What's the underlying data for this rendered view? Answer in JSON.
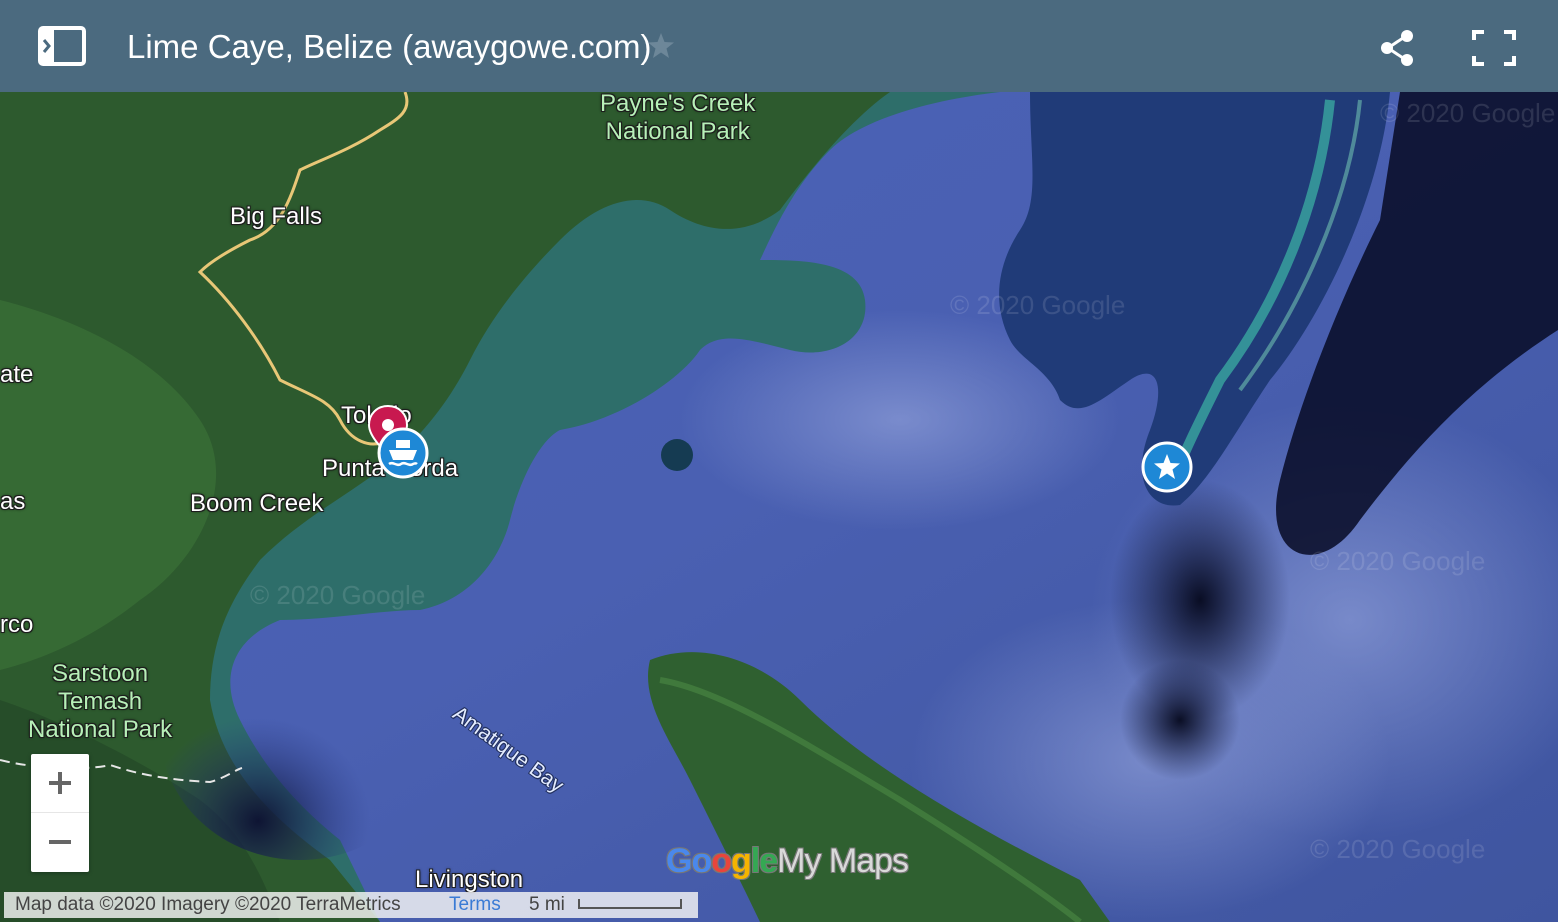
{
  "header": {
    "title": "Lime Caye, Belize (awaygowe.com)"
  },
  "icons": {
    "legend": "legend-panel-icon",
    "star": "star-icon",
    "share": "share-icon",
    "fullscreen": "fullscreen-icon",
    "zoom_in": "plus-icon",
    "zoom_out": "minus-icon"
  },
  "map": {
    "imagery": "satellite",
    "colors": {
      "header": "#4b6a7f",
      "water": "#4258a8",
      "land": "#2f5d33",
      "road": "#e8c777",
      "pin_red": "#c8194f",
      "pin_blue": "#1e88d6"
    },
    "places": {
      "paynes_creek_1": "Payne's Creek",
      "paynes_creek_2": "National Park",
      "big_falls": "Big Falls",
      "ate": "ate",
      "toledo": "Toledo",
      "punta_gorda": "Punta Gorda",
      "boom_creek": "Boom Creek",
      "as": "as",
      "rco": "rco",
      "sarstoon_1": "Sarstoon",
      "sarstoon_2": "Temash",
      "sarstoon_3": "National Park",
      "amatique_bay": "Amatique Bay",
      "livingston": "Livingston"
    },
    "watermark": "© 2020 Google",
    "markers": [
      {
        "name": "Toledo",
        "icon": "location-pin-icon",
        "color": "#c8194f"
      },
      {
        "name": "Punta Gorda",
        "icon": "ferry-icon",
        "color": "#1e88d6"
      },
      {
        "name": "Lime Caye",
        "icon": "star-icon",
        "color": "#1e88d6"
      }
    ]
  },
  "footer": {
    "attribution": "Map data ©2020 Imagery ©2020 TerraMetrics",
    "terms": "Terms",
    "scale": "5 mi"
  },
  "branding": {
    "g1": "Go",
    "g2": "o",
    "g3": "g",
    "g4": "le",
    "mymaps": "My Maps"
  }
}
